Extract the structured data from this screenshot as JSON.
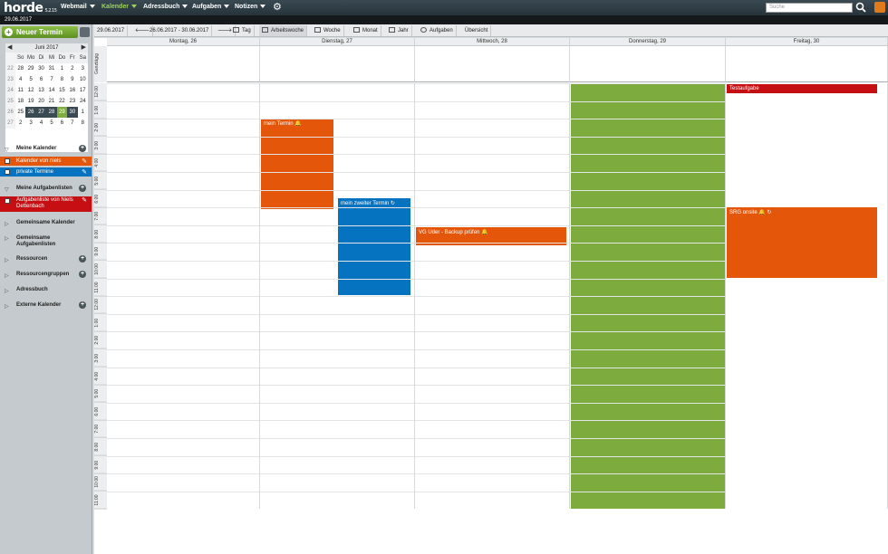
{
  "topbar": {
    "logo": "horde",
    "version": "5.2.15",
    "nav": [
      {
        "label": "Webmail"
      },
      {
        "label": "Kalender"
      },
      {
        "label": "Adressbuch"
      },
      {
        "label": "Aufgaben"
      },
      {
        "label": "Notizen"
      }
    ],
    "search_placeholder": "Suche",
    "date": "29.06.2017"
  },
  "sidebar": {
    "new_event": "Neuer Termin",
    "minical": {
      "month": "Juni 2017",
      "dow": [
        "So",
        "Mo",
        "Di",
        "Mi",
        "Do",
        "Fr",
        "Sa"
      ],
      "weeks": [
        {
          "wk": "22",
          "days": [
            "28",
            "29",
            "30",
            "31",
            "1",
            "2",
            "3"
          ]
        },
        {
          "wk": "23",
          "days": [
            "4",
            "5",
            "6",
            "7",
            "8",
            "9",
            "10"
          ]
        },
        {
          "wk": "24",
          "days": [
            "11",
            "12",
            "13",
            "14",
            "15",
            "16",
            "17"
          ]
        },
        {
          "wk": "25",
          "days": [
            "18",
            "19",
            "20",
            "21",
            "22",
            "23",
            "24"
          ]
        },
        {
          "wk": "26",
          "days": [
            "25",
            "26",
            "27",
            "28",
            "29",
            "30",
            "1"
          ]
        },
        {
          "wk": "27",
          "days": [
            "2",
            "3",
            "4",
            "5",
            "6",
            "7",
            "8"
          ]
        }
      ]
    },
    "sections": {
      "meine_kalender": "Meine Kalender",
      "cal1": "Kalender von niels",
      "cal2": "private Termine",
      "meine_aufgaben": "Meine Aufgabenlisten",
      "tasklist": "Aufgabenliste von Niels Dettenbach",
      "gemeinsame_kalender": "Gemeinsame Kalender",
      "gemeinsame_aufgaben": "Gemeinsame Aufgabenlisten",
      "ressourcen": "Ressourcen",
      "ressourcengruppen": "Ressourcengruppen",
      "adressbuch": "Adressbuch",
      "externe": "Externe Kalender"
    }
  },
  "toolbar": {
    "today": "29.06.2017",
    "range": "26.06.2017 - 30.06.2017",
    "tag": "Tag",
    "arbeitswoche": "Arbeitswoche",
    "woche": "Woche",
    "monat": "Monat",
    "jahr": "Jahr",
    "aufgaben": "Aufgaben",
    "uebersicht": "Übersicht"
  },
  "calendar": {
    "allday_label": "Ganztägig",
    "days": [
      "Montag, 26",
      "Dienstag, 27",
      "Mittwoch, 28",
      "Donnerstag, 29",
      "Freitag, 30"
    ],
    "hours": [
      "12:00",
      "1:00",
      "2:00",
      "3:00",
      "4:00",
      "5:00",
      "6:00",
      "7:00",
      "8:00",
      "9:00",
      "10:00",
      "11:00",
      "12:00",
      "1:00",
      "2:00",
      "3:00",
      "4:00",
      "5:00",
      "6:00",
      "7:00",
      "8:00",
      "9:00",
      "10:00",
      "11:00"
    ],
    "events": {
      "e1": "mein Termin",
      "e2": "mein zweiter Termin",
      "e3": "VG Uder - Backup prüfen",
      "e4": "Testaufgabe",
      "e5": "SRG onsite"
    }
  },
  "colors": {
    "orange": "#e4570a",
    "blue": "#0673c0",
    "green": "#7dab3e",
    "red": "#c50f12"
  }
}
